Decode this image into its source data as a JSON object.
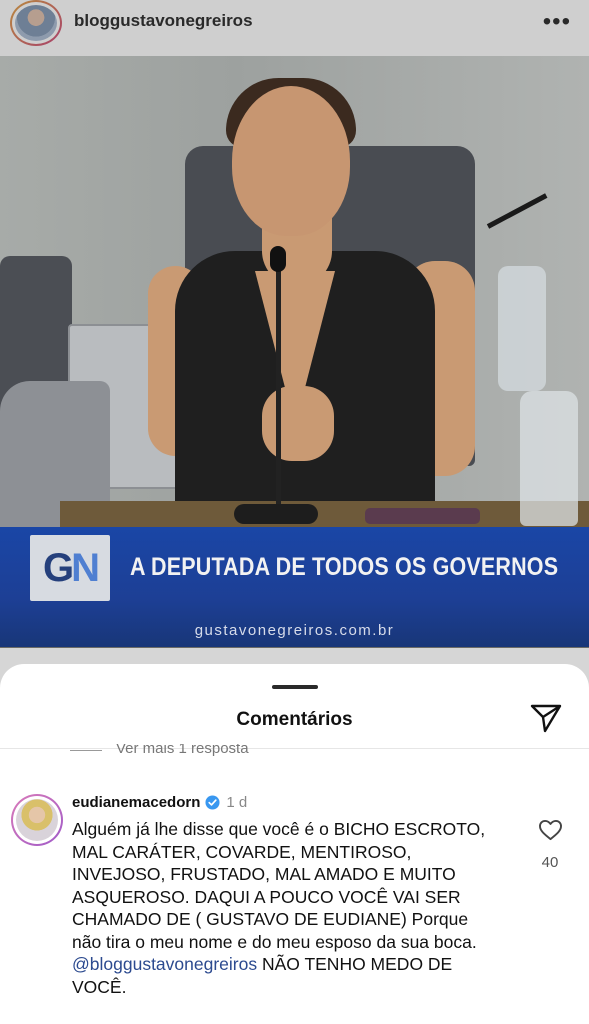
{
  "post": {
    "username": "bloggustavonegreiros",
    "more_icon": "more-horizontal-icon",
    "image": {
      "banner_logo_g": "G",
      "banner_logo_n": "N",
      "banner_title": "A DEPUTADA DE TODOS OS GOVERNOS",
      "banner_url": "gustavonegreiros.com.br"
    }
  },
  "comments_sheet": {
    "title": "Comentários",
    "share_icon": "send-icon",
    "view_more_replies": "Ver mais 1 resposta",
    "comment": {
      "username": "eudianemacedorn",
      "verified": true,
      "time": "1 d",
      "text": "Alguém já lhe disse que você é o BICHO ESCROTO, MAL CARÁTER, COVARDE, MENTIROSO, INVEJOSO, FRUSTADO, MAL AMADO E MUITO ASQUEROSO.  DAQUI A POUCO VOCÊ VAI SER CHAMADO DE ( GUSTAVO DE EUDIANE)  Porque não tira o meu nome e do meu esposo da sua boca.",
      "mention": "@bloggustavonegreiros",
      "text_after_mention": " NÃO TENHO MEDO DE VOCÊ.",
      "likes": "40"
    }
  },
  "colors": {
    "banner_blue": "#1d3f95",
    "verified_blue": "#3897f0",
    "mention_blue": "#2c4a8f"
  }
}
